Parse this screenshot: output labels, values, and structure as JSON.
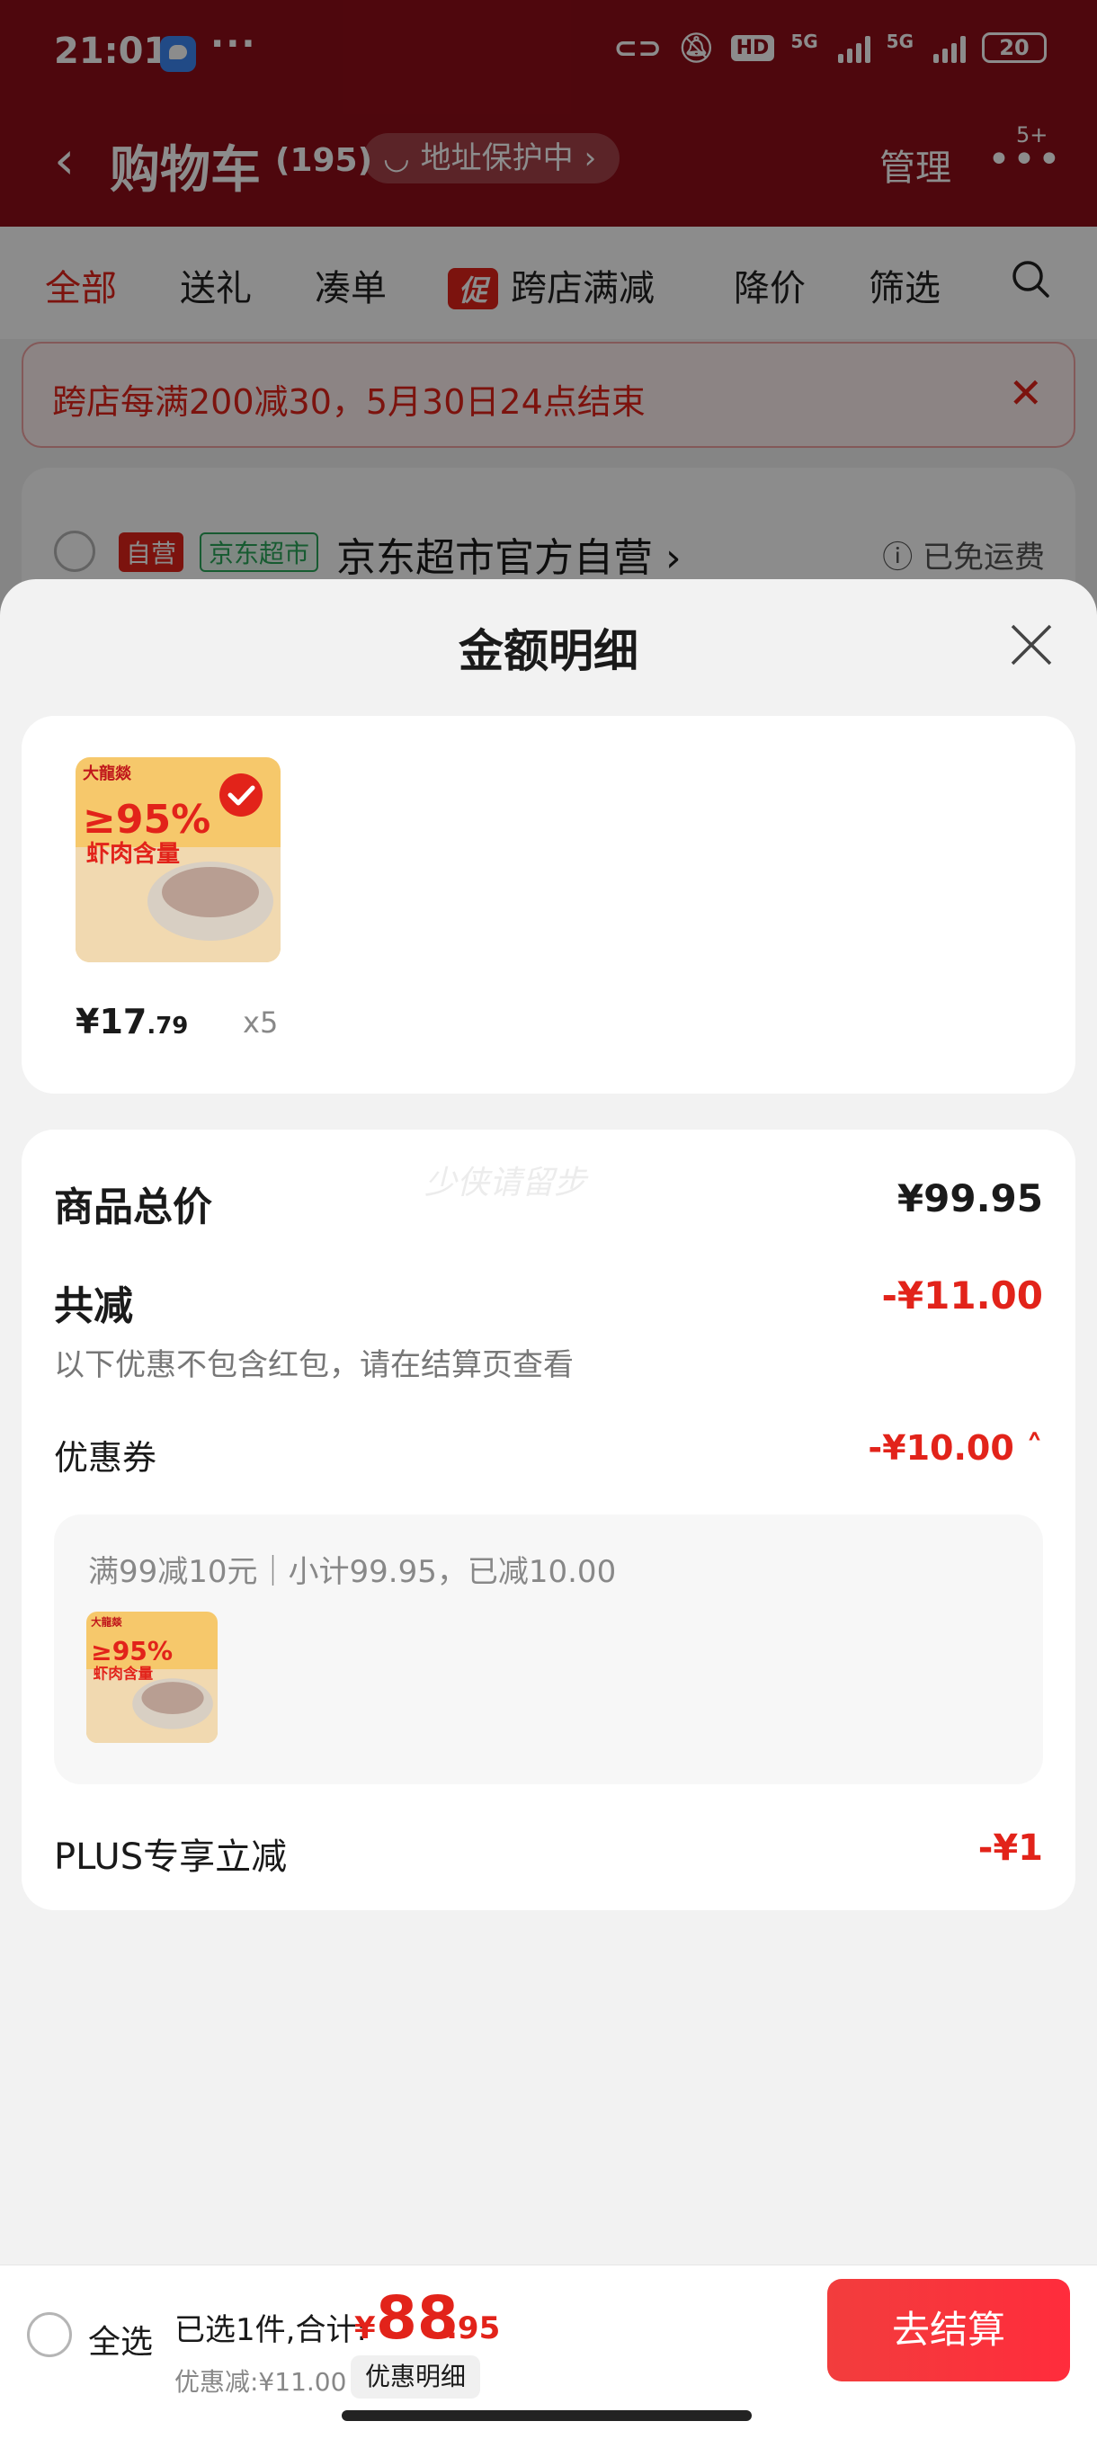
{
  "status_bar": {
    "time": "21:01",
    "dots": "···",
    "hd": "HD",
    "net1": "5G",
    "net2": "5G",
    "battery": "20"
  },
  "nav": {
    "back": "‹",
    "title": "购物车",
    "count": "(195)",
    "address_protect": "地址保护中",
    "address_chevron": "›",
    "manage": "管理",
    "more_badge": "5+"
  },
  "tabs": {
    "all": "全部",
    "gift": "送礼",
    "combine": "凑单",
    "promo_tag": "促",
    "cross_store": "跨店满减",
    "price_drop": "降价",
    "filter": "筛选"
  },
  "notice": {
    "text": "跨店每满200减30，5月30日24点结束",
    "close": "✕"
  },
  "store": {
    "tag_self": "自营",
    "tag_supermarket": "京东超市",
    "name": "京东超市官方自营 ›",
    "free_shipping": "ⓘ 已免运费"
  },
  "sheet": {
    "title": "金额明细",
    "product": {
      "price_main": "¥17",
      "price_decimal": ".79",
      "quantity": "x5",
      "image_brand": "大龍燚",
      "image_headline": "≥95%",
      "image_sub": "虾肉含量"
    },
    "watermark": "少侠请留步",
    "goods_total_label": "商品总价",
    "goods_total_value": "¥99.95",
    "total_discount_label": "共减",
    "total_discount_value": "-¥11.00",
    "note": "以下优惠不包含红包，请在结算页查看",
    "coupon_label": "优惠券",
    "coupon_value": "-¥10.00 ˄",
    "coupon_desc": "满99减10元｜小计99.95，已减10.00",
    "plus_label": "PLUS专享立减",
    "plus_value": "-¥1"
  },
  "bottom": {
    "select_all": "全选",
    "summary": "已选1件,合计:",
    "currency": "¥",
    "total_integer": "88",
    "total_decimal": ".95",
    "discount": "优惠减:¥11.00",
    "detail_button": "优惠明细",
    "checkout": "去结算"
  },
  "colors": {
    "brand_red": "#e2231a",
    "header_red": "#8f0d18"
  }
}
